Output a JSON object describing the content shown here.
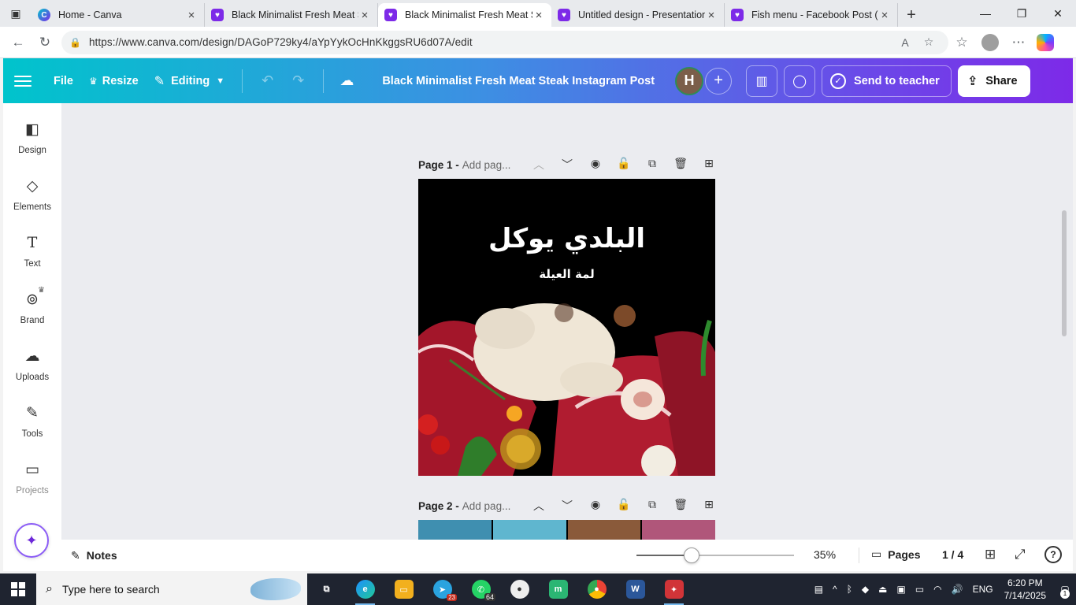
{
  "browser": {
    "tabs": [
      {
        "title": "Home - Canva",
        "favicon": "canva-icon",
        "active": false
      },
      {
        "title": "Black Minimalist Fresh Meat St",
        "favicon": "canva-design-icon",
        "active": false
      },
      {
        "title": "Black Minimalist Fresh Meat St",
        "favicon": "canva-design-icon",
        "active": true
      },
      {
        "title": "Untitled design - Presentation",
        "favicon": "canva-design-icon",
        "active": false
      },
      {
        "title": "Fish menu - Facebook Post (Sc",
        "favicon": "canva-design-icon",
        "active": false
      }
    ],
    "url": "https://www.canva.com/design/DAGoP729ky4/aYpYykOcHnKkggsRU6d07A/edit"
  },
  "toolbar": {
    "file_label": "File",
    "resize_label": "Resize",
    "editing_label": "Editing",
    "doc_title": "Black Minimalist Fresh Meat Steak Instagram Post",
    "avatar_initial": "H",
    "send_label": "Send to teacher",
    "share_label": "Share"
  },
  "sidebar": {
    "items": [
      {
        "label": "Design",
        "icon": "design-icon"
      },
      {
        "label": "Elements",
        "icon": "elements-icon"
      },
      {
        "label": "Text",
        "icon": "text-icon"
      },
      {
        "label": "Brand",
        "icon": "brand-icon"
      },
      {
        "label": "Uploads",
        "icon": "uploads-icon"
      },
      {
        "label": "Tools",
        "icon": "tools-icon"
      },
      {
        "label": "Projects",
        "icon": "projects-icon"
      }
    ]
  },
  "pages": [
    {
      "name": "Page 1 -",
      "add_title": "Add pag..."
    },
    {
      "name": "Page 2 -",
      "add_title": "Add pag..."
    }
  ],
  "design": {
    "title": "البلدي يوكل",
    "subtitle": "لمة العيلة",
    "background": "#000000"
  },
  "bottom": {
    "notes_label": "Notes",
    "zoom_value": 0.35,
    "zoom_text": "35%",
    "pages_label": "Pages",
    "page_count": "1 / 4"
  },
  "taskbar": {
    "search_placeholder": "Type here to search",
    "telegram_badge": "23",
    "whatsapp_badge": "64",
    "language": "ENG",
    "time": "6:20 PM",
    "date": "7/14/2025",
    "notifications": "1"
  },
  "colors": {
    "accent_gradient_start": "#00c4cc",
    "accent_gradient_end": "#7d2ae8"
  }
}
